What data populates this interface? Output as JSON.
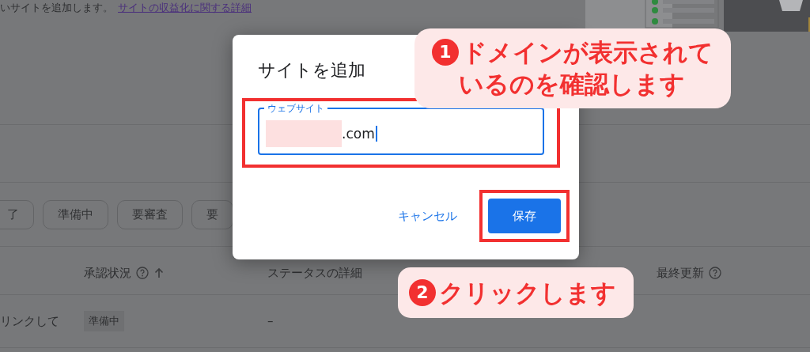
{
  "page": {
    "intro": "いサイトを追加します。",
    "intro_link": "サイトの収益化に関する詳細",
    "filters": [
      {
        "label": "了"
      },
      {
        "label": "準備中"
      },
      {
        "label": "要審査"
      },
      {
        "label": "要"
      }
    ],
    "table": {
      "columns": [
        {
          "label": "承認状況",
          "help": true,
          "sorted": true
        },
        {
          "label": "ステータスの詳細",
          "help": false,
          "sorted": false
        },
        {
          "label": "最終更新",
          "help": true,
          "sorted": false
        }
      ],
      "rows": [
        {
          "site": "リンクして",
          "status": "準備中",
          "detail": "–"
        }
      ]
    }
  },
  "dialog": {
    "title": "サイトを追加",
    "field": {
      "label": "ウェブサイト",
      "value": ".com",
      "redacted": true
    },
    "buttons": [
      {
        "label": "キャンセル",
        "kind": "text"
      },
      {
        "label": "保存",
        "kind": "primary"
      }
    ]
  },
  "callouts": [
    {
      "number": "1",
      "lines": [
        "ドメインが表示されて",
        "いるのを確認します"
      ]
    },
    {
      "number": "2",
      "lines": [
        "クリックします"
      ]
    }
  ]
}
